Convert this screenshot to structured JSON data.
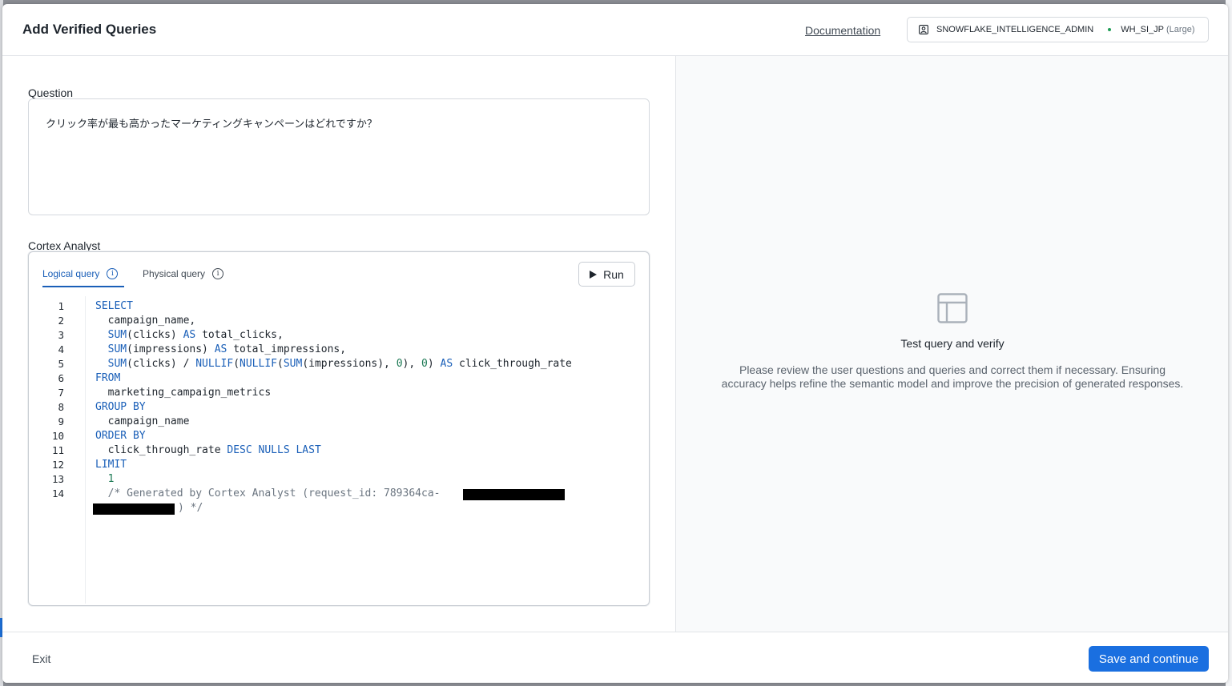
{
  "header": {
    "title": "Add Verified Queries",
    "documentation_link": "Documentation",
    "role": "SNOWFLAKE_INTELLIGENCE_ADMIN",
    "warehouse": "WH_SI_JP",
    "warehouse_size": "(Large)"
  },
  "question": {
    "label": "Question",
    "value": "クリック率が最も高かったマーケティングキャンペーンはどれですか？"
  },
  "analyst": {
    "label": "Cortex Analyst",
    "tabs": [
      {
        "label": "Logical query",
        "active": true
      },
      {
        "label": "Physical query",
        "active": false
      }
    ],
    "run_label": "Run",
    "line_numbers": [
      "1",
      "2",
      "3",
      "4",
      "5",
      "6",
      "7",
      "8",
      "9",
      "10",
      "11",
      "12",
      "13",
      "14"
    ],
    "code": [
      [
        {
          "t": "SELECT",
          "c": "kw"
        }
      ],
      [
        {
          "t": "  campaign_name,",
          "c": ""
        }
      ],
      [
        {
          "t": "  ",
          "c": ""
        },
        {
          "t": "SUM",
          "c": "fn"
        },
        {
          "t": "(clicks) ",
          "c": ""
        },
        {
          "t": "AS",
          "c": "kw"
        },
        {
          "t": " total_clicks,",
          "c": ""
        }
      ],
      [
        {
          "t": "  ",
          "c": ""
        },
        {
          "t": "SUM",
          "c": "fn"
        },
        {
          "t": "(impressions) ",
          "c": ""
        },
        {
          "t": "AS",
          "c": "kw"
        },
        {
          "t": " total_impressions,",
          "c": ""
        }
      ],
      [
        {
          "t": "  ",
          "c": ""
        },
        {
          "t": "SUM",
          "c": "fn"
        },
        {
          "t": "(clicks) / ",
          "c": ""
        },
        {
          "t": "NULLIF",
          "c": "fn"
        },
        {
          "t": "(",
          "c": ""
        },
        {
          "t": "NULLIF",
          "c": "fn"
        },
        {
          "t": "(",
          "c": ""
        },
        {
          "t": "SUM",
          "c": "fn"
        },
        {
          "t": "(impressions), ",
          "c": ""
        },
        {
          "t": "0",
          "c": "num"
        },
        {
          "t": "), ",
          "c": ""
        },
        {
          "t": "0",
          "c": "num"
        },
        {
          "t": ") ",
          "c": ""
        },
        {
          "t": "AS",
          "c": "kw"
        },
        {
          "t": " click_through_rate",
          "c": ""
        }
      ],
      [
        {
          "t": "FROM",
          "c": "kw"
        }
      ],
      [
        {
          "t": "  marketing_campaign_metrics",
          "c": ""
        }
      ],
      [
        {
          "t": "GROUP BY",
          "c": "kw"
        }
      ],
      [
        {
          "t": "  campaign_name",
          "c": ""
        }
      ],
      [
        {
          "t": "ORDER BY",
          "c": "kw"
        }
      ],
      [
        {
          "t": "  click_through_rate ",
          "c": ""
        },
        {
          "t": "DESC NULLS LAST",
          "c": "kw"
        }
      ],
      [
        {
          "t": "LIMIT",
          "c": "kw"
        }
      ],
      [
        {
          "t": "  ",
          "c": ""
        },
        {
          "t": "1",
          "c": "num"
        }
      ],
      [
        {
          "t": "  /* Generated by Cortex Analyst (request_id: 789364ca-",
          "c": "cmt"
        }
      ]
    ],
    "comment_tail": ") */"
  },
  "results_panel": {
    "title": "Test query and verify",
    "description": "Please review the user questions and queries and correct them if necessary. Ensuring accuracy helps refine the semantic model and improve the precision of generated responses.",
    "icon": "table-layout-icon"
  },
  "footer": {
    "exit_label": "Exit",
    "save_label": "Save and continue"
  },
  "colors": {
    "accent": "#1a6fe0",
    "keyword": "#1a5fb8",
    "number": "#1d7a55",
    "comment": "#6b7580"
  }
}
